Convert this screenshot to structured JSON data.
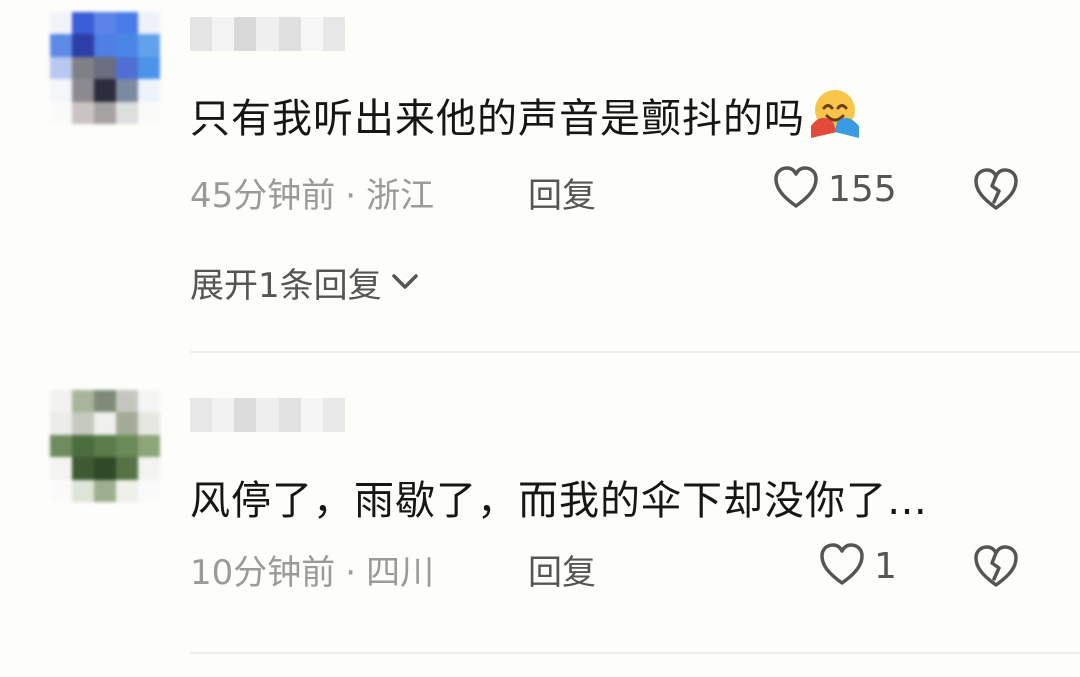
{
  "comments": [
    {
      "text": "只有我听出来他的声音是颤抖的吗",
      "time": "45分钟前",
      "location": "浙江",
      "reply_label": "回复",
      "likes": "155",
      "expand_label": "展开1条回复"
    },
    {
      "text": "风停了，雨歇了，而我的伞下却没你了…",
      "time": "10分钟前",
      "location": "四川",
      "reply_label": "回复",
      "likes": "1"
    }
  ],
  "separator": "·",
  "colors": {
    "text": "#161616",
    "meta": "#9a9a9a",
    "icon": "#555555",
    "background": "#fdfdf9"
  },
  "icons": [
    "heart-icon",
    "broken-heart-icon",
    "chevron-down-icon",
    "hugging-face-emoji"
  ]
}
